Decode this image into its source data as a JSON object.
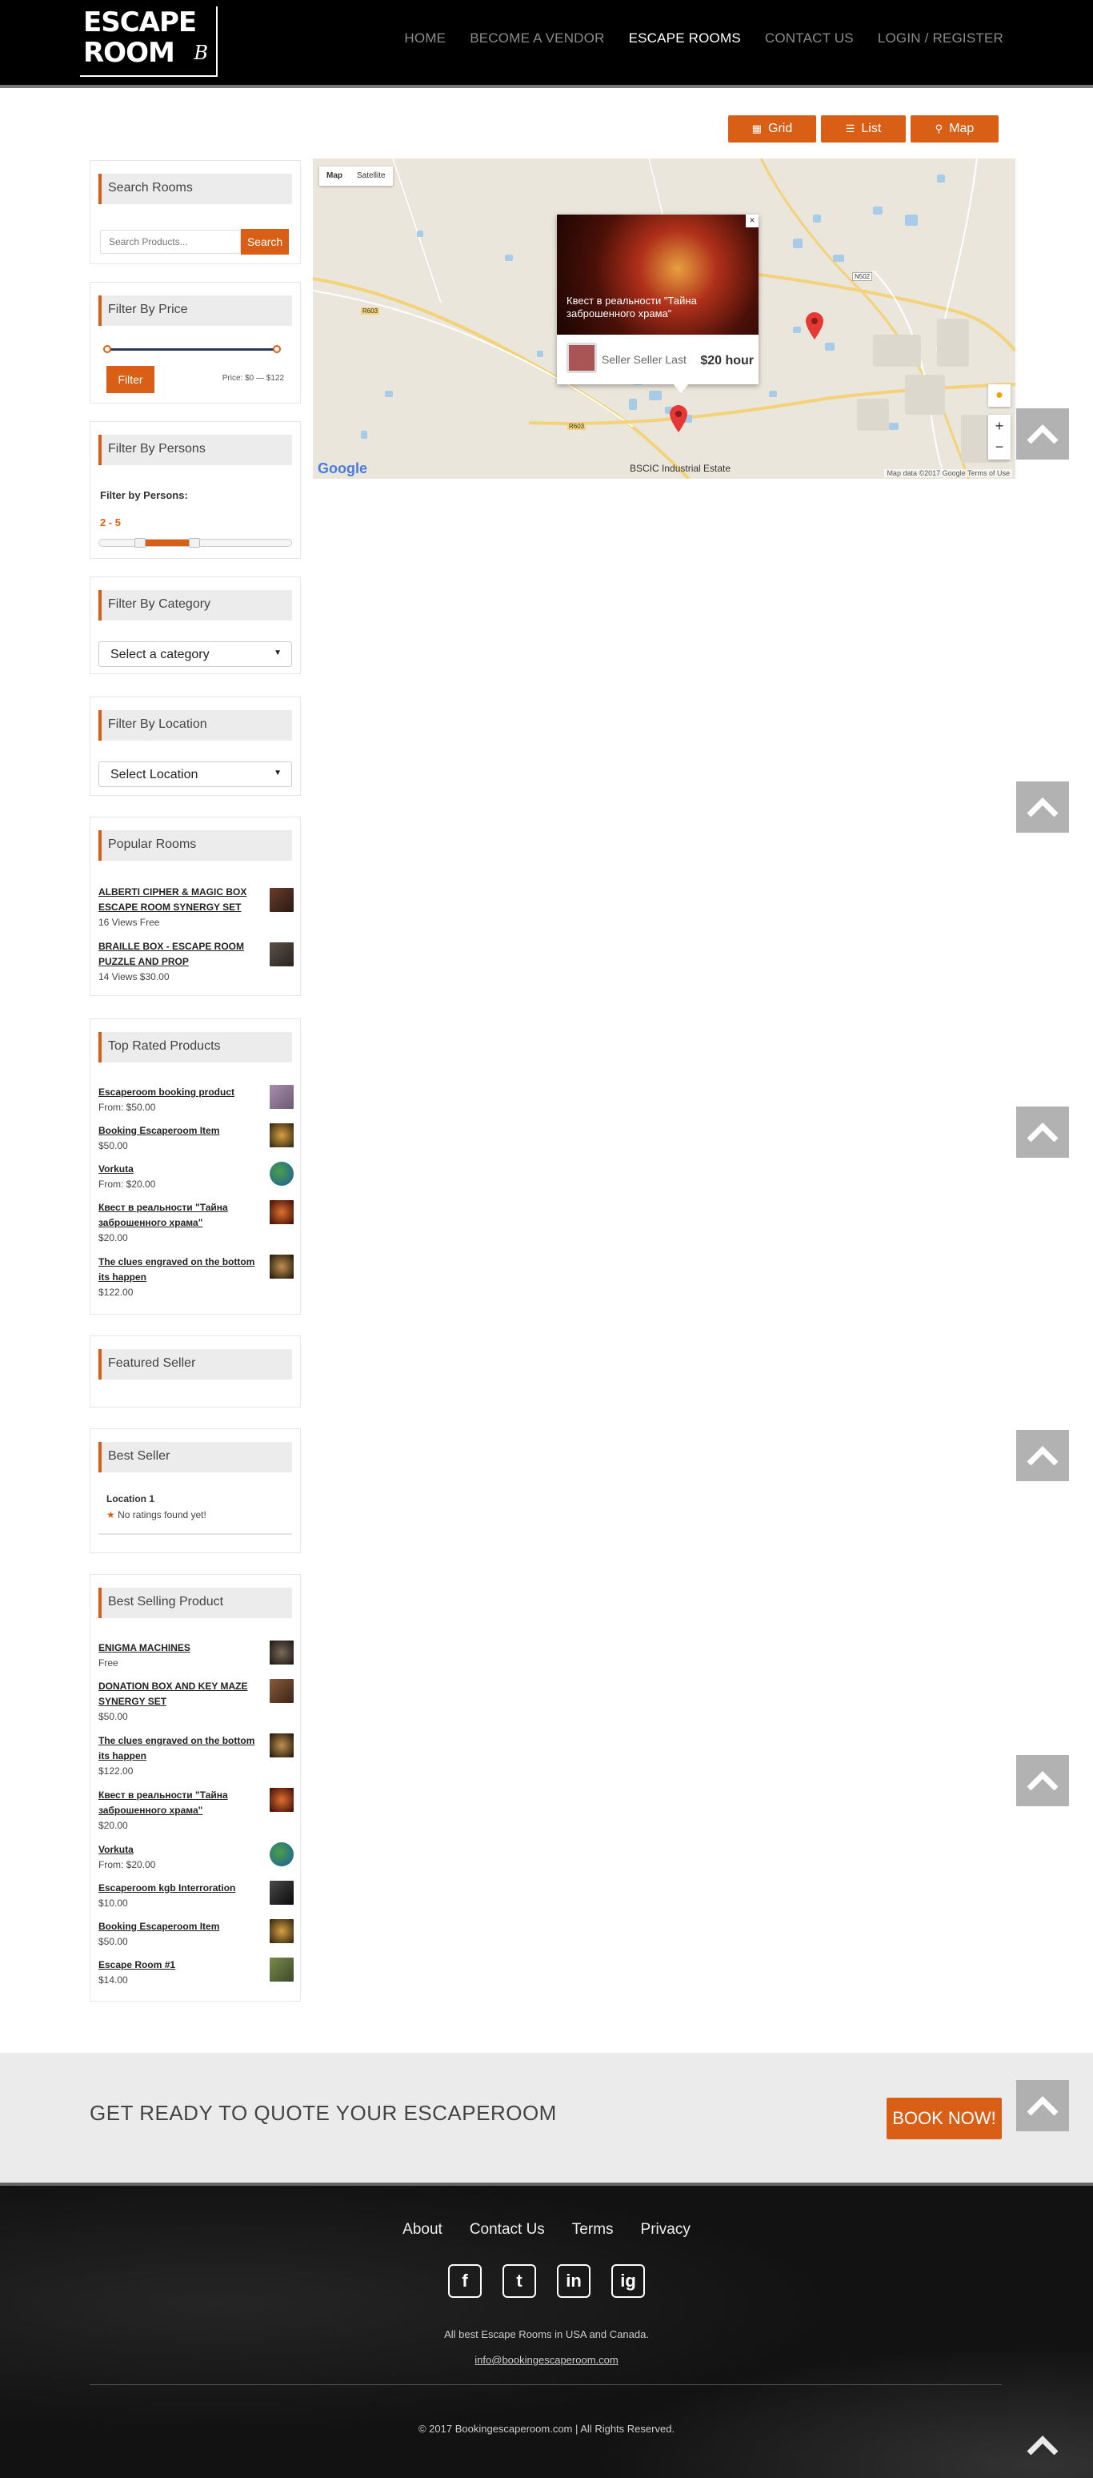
{
  "header": {
    "logo_line1": "ESCAPE",
    "logo_line2": "ROOM",
    "logo_b": "B",
    "nav": [
      "HOME",
      "BECOME A VENDOR",
      "ESCAPE ROOMS",
      "CONTACT US",
      "LOGIN / REGISTER"
    ],
    "active_nav": "ESCAPE ROOMS"
  },
  "view_buttons": {
    "grid": "Grid",
    "list": "List",
    "map": "Map"
  },
  "sidebar": {
    "search": {
      "title": "Search Rooms",
      "placeholder": "Search Products...",
      "button": "Search"
    },
    "price": {
      "title": "Filter By Price",
      "button": "Filter",
      "label": "Price: $0 — $122"
    },
    "persons": {
      "title": "Filter By Persons",
      "label": "Filter by Persons:",
      "range": "2 - 5"
    },
    "category": {
      "title": "Filter By Category",
      "selected": "Select a category"
    },
    "location": {
      "title": "Filter By Location",
      "selected": "Select Location"
    },
    "popular": {
      "title": "Popular Rooms",
      "items": [
        {
          "name": "ALBERTI CIPHER & MAGIC BOX ESCAPE ROOM SYNERGY SET",
          "meta": "16 Views Free"
        },
        {
          "name": "BRAILLE BOX - ESCAPE ROOM PUZZLE AND PROP",
          "meta": "14 Views $30.00"
        }
      ]
    },
    "top_rated": {
      "title": "Top Rated Products",
      "items": [
        {
          "name": "Escaperoom booking product",
          "price": "From: $50.00"
        },
        {
          "name": "Booking Escaperoom Item",
          "price": "$50.00"
        },
        {
          "name": "Vorkuta",
          "price": "From: $20.00"
        },
        {
          "name": "Квест в реальности \"Тайна заброшенного храма\"",
          "price": "$20.00"
        },
        {
          "name": "The clues engraved on the bottom its happen",
          "price": "$122.00"
        }
      ]
    },
    "featured_seller": {
      "title": "Featured Seller"
    },
    "best_seller": {
      "title": "Best Seller",
      "name": "Location 1",
      "rating": "No ratings found yet!"
    },
    "best_selling": {
      "title": "Best Selling Product",
      "items": [
        {
          "name": "ENIGMA MACHINES",
          "price": "Free"
        },
        {
          "name": "DONATION BOX AND KEY MAZE SYNERGY SET",
          "price": "$50.00"
        },
        {
          "name": "The clues engraved on the bottom its happen",
          "price": "$122.00"
        },
        {
          "name": "Квест в реальности \"Тайна заброшенного храма\"",
          "price": "$20.00"
        },
        {
          "name": "Vorkuta",
          "price": "From: $20.00"
        },
        {
          "name": "Escaperoom kgb Interroration",
          "price": "$10.00"
        },
        {
          "name": "Booking Escaperoom Item",
          "price": "$50.00"
        },
        {
          "name": "Escape Room #1",
          "price": "$14.00"
        }
      ]
    }
  },
  "map": {
    "toggle": [
      "Map",
      "Satellite"
    ],
    "popup": {
      "title": "Квест в реальности \"Тайна заброшенного храма\"",
      "seller": "Seller Seller Last",
      "price": "$20 hour"
    },
    "place_label": "BSCIC Industrial Estate",
    "road_labels": [
      "R603",
      "R603",
      "N502"
    ],
    "attribution": "Map data ©2017 Google   Terms of Use",
    "google": "Google"
  },
  "cta": {
    "text": "GET READY TO QUOTE YOUR ESCAPEROOM",
    "button": "BOOK NOW!"
  },
  "footer": {
    "links": [
      "About",
      "Contact Us",
      "Terms",
      "Privacy"
    ],
    "social": [
      "f",
      "t",
      "in",
      "ig"
    ],
    "tagline": "All best Escape Rooms in USA and Canada.",
    "email": "info@bookingescaperoom.com",
    "copyright": "© 2017 Bookingescaperoom.com | All Rights Reserved."
  },
  "colors": {
    "accent": "#d85f15",
    "header": "#000000",
    "footer": "#121212"
  }
}
